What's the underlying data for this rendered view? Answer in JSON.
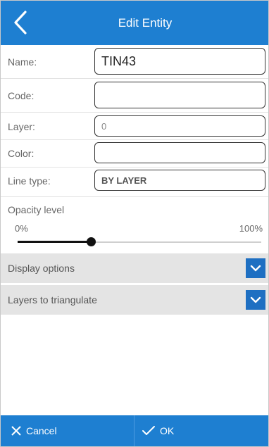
{
  "header": {
    "title": "Edit Entity",
    "back_icon": "chevron-left-icon"
  },
  "form": {
    "name_label": "Name:",
    "name_value": "TIN43",
    "code_label": "Code:",
    "code_value": "",
    "layer_label": "Layer:",
    "layer_value": "0",
    "color_label": "Color:",
    "color_value": "",
    "linetype_label": "Line type:",
    "linetype_value": "BY LAYER"
  },
  "opacity": {
    "label": "Opacity level",
    "min_label": "0%",
    "max_label": "100%",
    "value_fraction": 0.3
  },
  "sections": {
    "display_options": "Display options",
    "layers_to_triangulate": "Layers to triangulate",
    "toggle_icon": "chevron-down-icon"
  },
  "footer": {
    "cancel_label": "Cancel",
    "cancel_icon": "close-icon",
    "ok_label": "OK",
    "ok_icon": "check-icon"
  },
  "colors": {
    "accent": "#1e7fd1",
    "toggle": "#1e6fc2",
    "section_bg": "#e4e4e4"
  }
}
